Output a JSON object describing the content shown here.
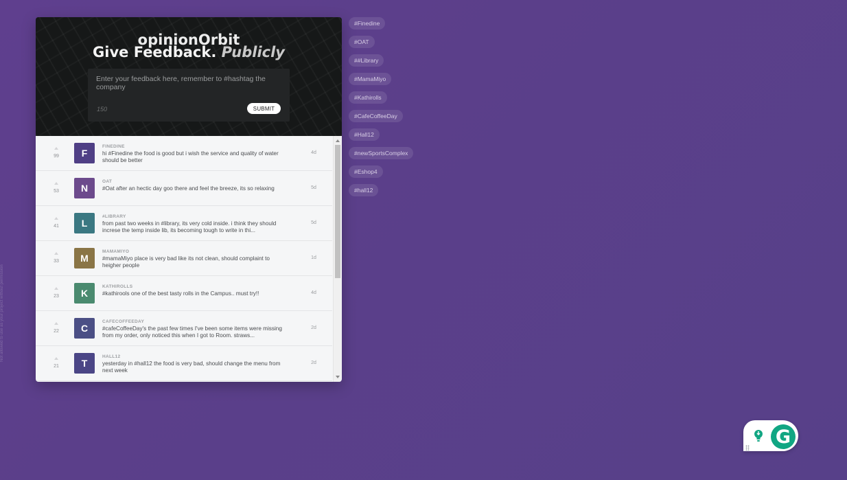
{
  "side_note": "Not allowed to use as your project without permission",
  "header": {
    "app_name": "opinionOrbit",
    "tagline_main": "Give Feedback.",
    "tagline_em": "Publicly",
    "input_placeholder": "Enter your feedback here, remember to #hashtag the company",
    "input_value": "",
    "char_count": "150",
    "submit_label": "SUBMIT"
  },
  "feedback": [
    {
      "votes": "99",
      "initial": "F",
      "color": "#4f3f85",
      "company": "FINEDINE",
      "text": "hi #Finedine the food is good but i wish the service and quality of water should be better",
      "age": "4d"
    },
    {
      "votes": "53",
      "initial": "N",
      "color": "#6c4a8c",
      "company": "OAT",
      "text": "#Oat after an hectic day goo there and feel the breeze, its so relaxing",
      "age": "5d"
    },
    {
      "votes": "41",
      "initial": "L",
      "color": "#3b7882",
      "company": "#LIBRARY",
      "text": "from past two weeks in #library, its very cold inside. i think they should increse the temp inside lib, its becoming tough to write in thi...",
      "age": "5d"
    },
    {
      "votes": "33",
      "initial": "M",
      "color": "#8a7546",
      "company": "MAMAMIYO",
      "text": "#mamaMiyo place is very bad like its not clean, should complaint to heigher people",
      "age": "1d"
    },
    {
      "votes": "23",
      "initial": "K",
      "color": "#4a8a6f",
      "company": "KATHIROLLS",
      "text": "#kathirools one of the best tasty rolls in the Campus.. must try!!",
      "age": "4d"
    },
    {
      "votes": "22",
      "initial": "C",
      "color": "#4b4f85",
      "company": "CAFECOFFEEDAY",
      "text": "#cafeCoffeeDay's the past few times I've been some items were missing from my order, only noticed this when I got to Room. straws...",
      "age": "2d"
    },
    {
      "votes": "21",
      "initial": "T",
      "color": "#4b4686",
      "company": "HALL12",
      "text": "yesterday in #hall12 the food is very bad, should change the menu from next week",
      "age": "2d"
    }
  ],
  "hashtags": [
    "#Finedine",
    "#OAT",
    "##Library",
    "#MamaMiyo",
    "#Kathirolls",
    "#CafeCoffeeDay",
    "#Hall12",
    "#newSportsComplex",
    "#Eshop4",
    "#hall12"
  ],
  "grammarly": {
    "logo": "G"
  }
}
